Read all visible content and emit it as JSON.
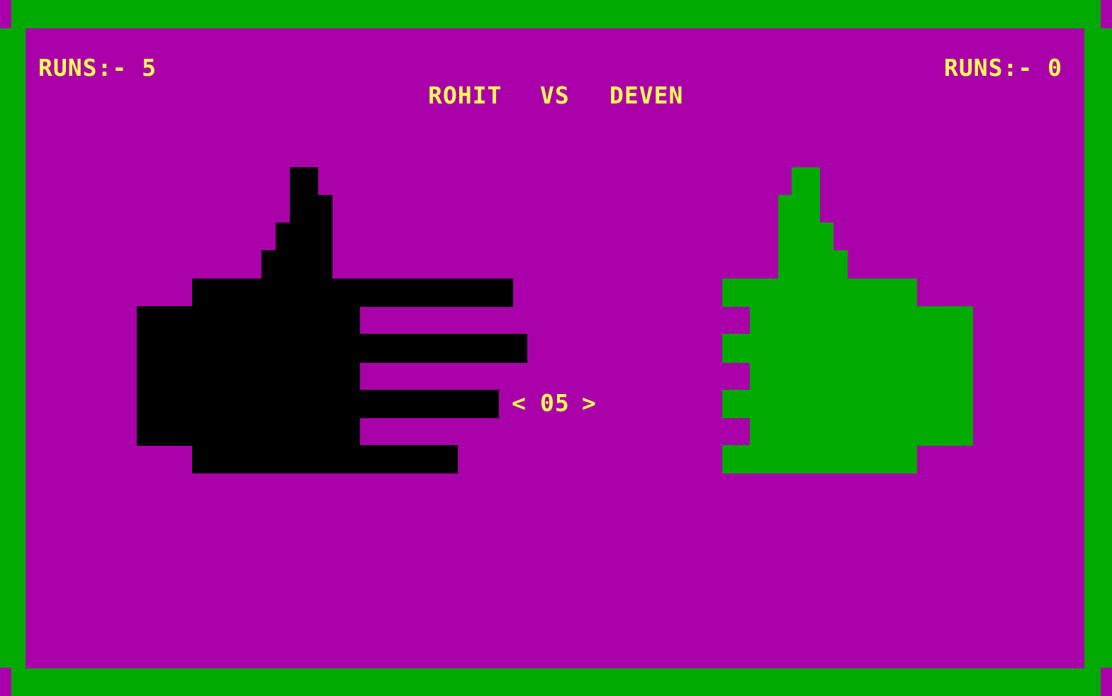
{
  "colors": {
    "border": "#00AA00",
    "field": "#AA00AA",
    "text": "#FFFF55",
    "player_hand": "#000000",
    "opponent_hand": "#00AA00"
  },
  "player": {
    "name": "ROHIT",
    "runs_label": "RUNS:- 5",
    "hand_gesture": "five-fingers-pointing-right"
  },
  "versus": "VS",
  "opponent": {
    "name": "DEVEN",
    "runs_label": "RUNS:- 0",
    "hand_gesture": "thumbs-up"
  },
  "selector": {
    "left_arrow": "<",
    "value": "05",
    "right_arrow": ">"
  }
}
